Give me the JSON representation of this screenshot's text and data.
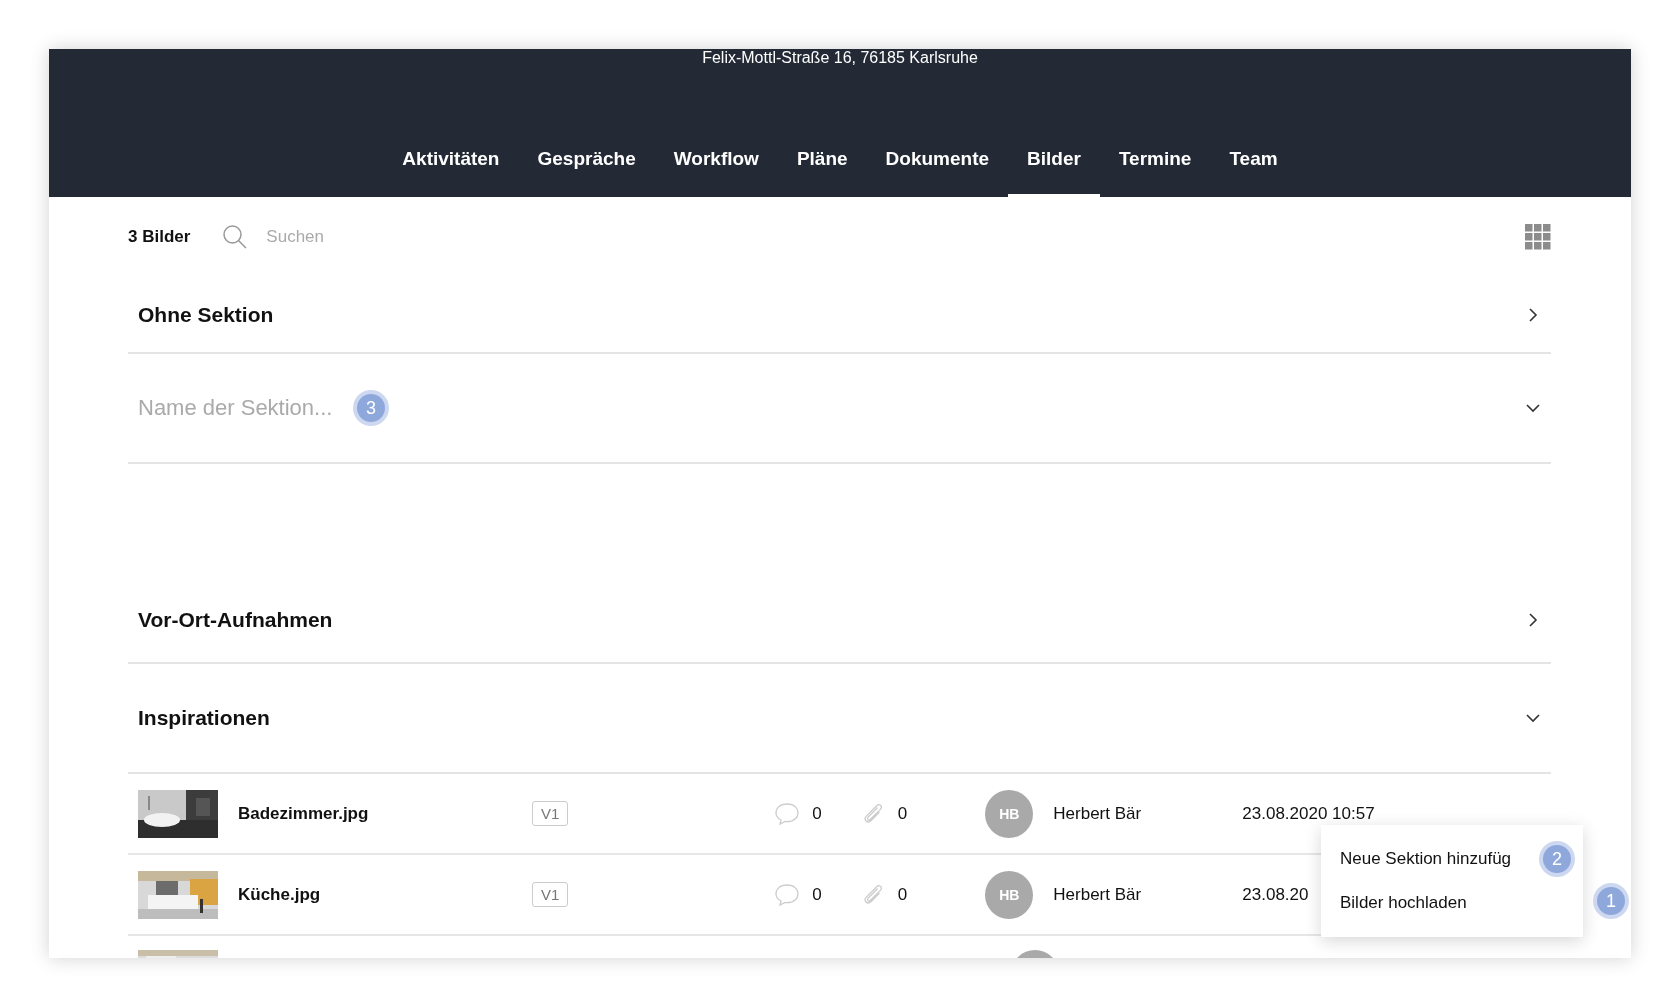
{
  "header": {
    "address": "Felix-Mottl-Straße 16, 76185 Karlsruhe"
  },
  "tabs": [
    {
      "label": "Aktivitäten",
      "selected": false
    },
    {
      "label": "Gespräche",
      "selected": false
    },
    {
      "label": "Workflow",
      "selected": false
    },
    {
      "label": "Pläne",
      "selected": false
    },
    {
      "label": "Dokumente",
      "selected": false
    },
    {
      "label": "Bilder",
      "selected": true
    },
    {
      "label": "Termine",
      "selected": false
    },
    {
      "label": "Team",
      "selected": false
    }
  ],
  "toolbar": {
    "count": "3 Bilder",
    "search": {
      "placeholder": "Suchen"
    }
  },
  "sections": [
    {
      "kind": "title",
      "title": "Ohne Sektion",
      "expanded": false
    },
    {
      "kind": "input",
      "placeholder": "Name der Sektion...",
      "expanded": true,
      "marker": "3"
    },
    {
      "kind": "title",
      "title": "Vor-Ort-Aufnahmen",
      "expanded": false
    },
    {
      "kind": "title",
      "title": "Inspirationen",
      "expanded": true
    }
  ],
  "images": [
    {
      "name": "Badezimmer.jpg",
      "version": "V1",
      "comments": "0",
      "attachments": "0",
      "avatar": "HB",
      "author": "Herbert Bär",
      "date": "23.08.2020 10:57"
    },
    {
      "name": "Küche.jpg",
      "version": "V1",
      "comments": "0",
      "attachments": "0",
      "avatar": "HB",
      "author": "Herbert Bär",
      "date": "23.08.20"
    }
  ],
  "more_rows_below": true,
  "context_menu": {
    "items": [
      {
        "label": "Neue Sektion hinzufüg",
        "marker": "2"
      },
      {
        "label": "Bilder hochladen"
      }
    ]
  },
  "fab_marker": "1"
}
